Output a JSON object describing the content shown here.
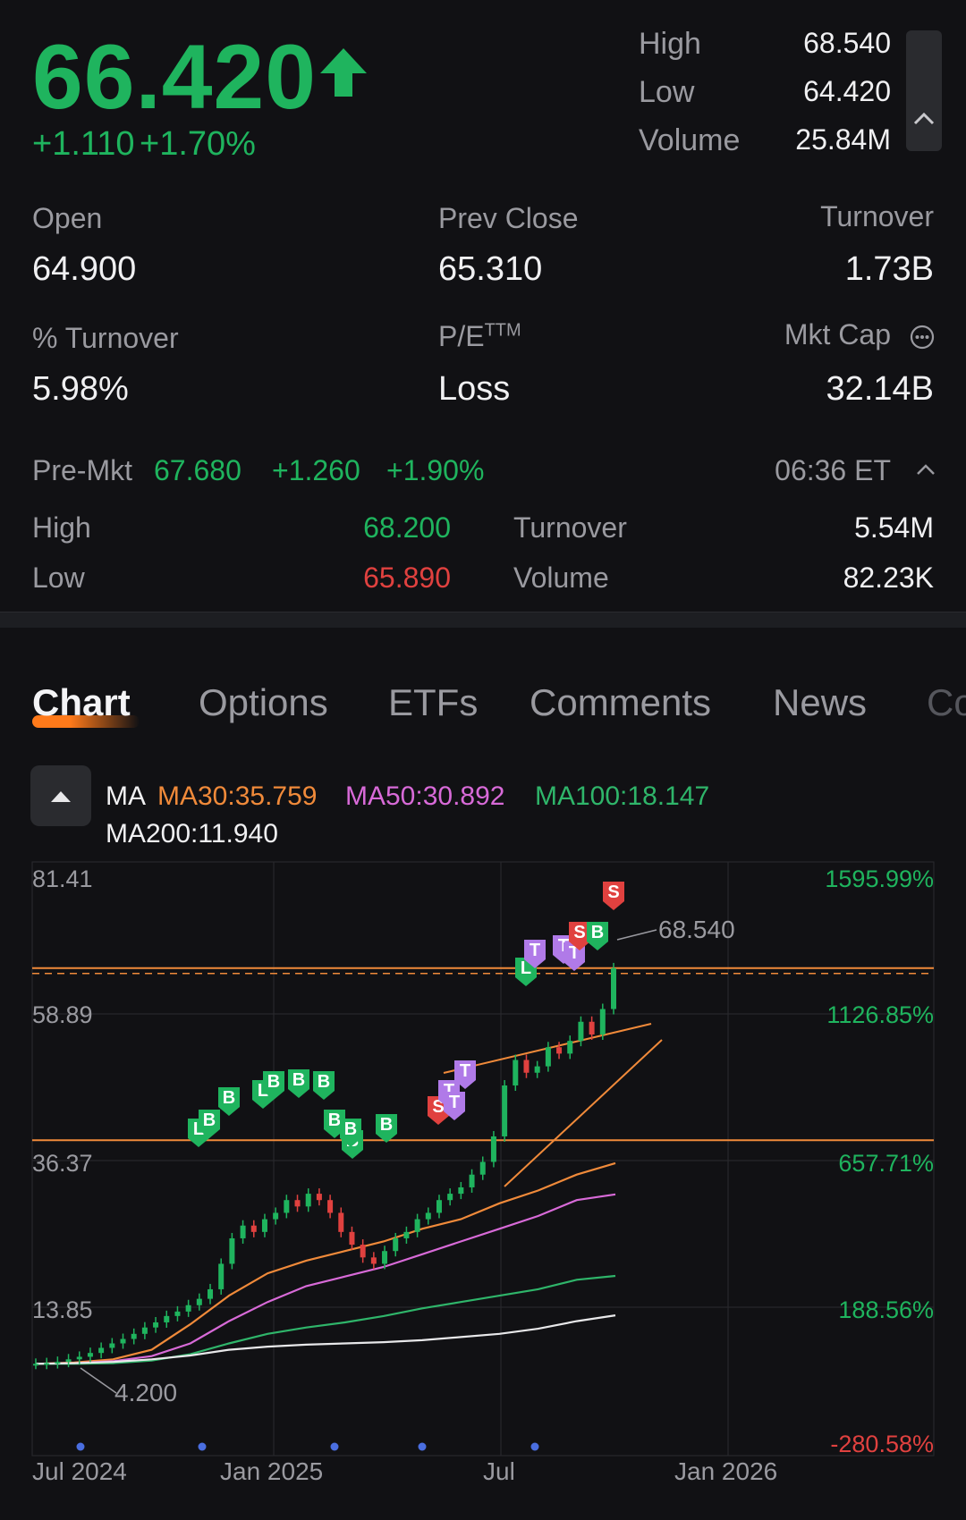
{
  "quote": {
    "price": "66.420",
    "change": "+1.110",
    "change_pct": "+1.70%",
    "high_label": "High",
    "high": "68.540",
    "low_label": "Low",
    "low": "64.420",
    "volume_label": "Volume",
    "volume": "25.84M"
  },
  "stats": {
    "open_label": "Open",
    "open": "64.900",
    "prev_close_label": "Prev Close",
    "prev_close": "65.310",
    "turnover_label": "Turnover",
    "turnover": "1.73B",
    "pct_turnover_label": "% Turnover",
    "pct_turnover": "5.98%",
    "pe_label": "P/E",
    "pe_sup": "TTM",
    "pe": "Loss",
    "mkt_cap_label": "Mkt Cap",
    "mkt_cap": "32.14B"
  },
  "premarket": {
    "label": "Pre-Mkt",
    "price": "67.680",
    "change": "+1.260",
    "change_pct": "+1.90%",
    "time": "06:36 ET",
    "high_label": "High",
    "high": "68.200",
    "low_label": "Low",
    "low": "65.890",
    "turnover_label": "Turnover",
    "turnover": "5.54M",
    "volume_label": "Volume",
    "volume": "82.23K"
  },
  "tabs": [
    "Chart",
    "Options",
    "ETFs",
    "Comments",
    "News",
    "Co"
  ],
  "ma": {
    "label": "MA",
    "ma30": "MA30:35.759",
    "ma50": "MA50:30.892",
    "ma100": "MA100:18.147",
    "ma200": "MA200:11.940"
  },
  "colors": {
    "up": "#1fb45e",
    "down": "#e0413f",
    "ma30": "#f08a3a",
    "ma50": "#d86ad8",
    "ma100": "#2fb56a",
    "ma200": "#e8e8ea",
    "bg": "#111114"
  },
  "chart_data": {
    "type": "line",
    "y_left_ticks": [
      "81.41",
      "58.89",
      "36.37",
      "13.85"
    ],
    "y_right_ticks": [
      "1595.99%",
      "1126.85%",
      "657.71%",
      "188.56%",
      "-280.58%"
    ],
    "x_ticks": [
      "Jul 2024",
      "Jan 2025",
      "Jul",
      "Jan 2026"
    ],
    "annotations": {
      "high_label": "68.540",
      "low_label": "4.200"
    },
    "ylim": [
      4.2,
      81.41
    ],
    "x": [
      "2024-07",
      "2024-08",
      "2024-09",
      "2024-10",
      "2024-11",
      "2024-12",
      "2025-01",
      "2025-02",
      "2025-03",
      "2025-04",
      "2025-05",
      "2025-06",
      "2025-07",
      "2025-08",
      "2025-09",
      "2025-10"
    ],
    "series": [
      {
        "name": "MA30",
        "values": [
          4.3,
          4.5,
          5.0,
          6.5,
          10.5,
          15.0,
          18.5,
          20.5,
          22.0,
          23.5,
          25.5,
          27.0,
          29.5,
          31.5,
          34.0,
          35.8
        ]
      },
      {
        "name": "MA50",
        "values": [
          4.3,
          4.4,
          4.7,
          5.5,
          7.5,
          11.0,
          14.0,
          16.5,
          18.0,
          19.5,
          21.5,
          23.5,
          25.5,
          27.5,
          30.0,
          30.9
        ]
      },
      {
        "name": "MA100",
        "values": [
          4.3,
          4.3,
          4.4,
          4.8,
          5.8,
          7.5,
          9.0,
          10.0,
          10.8,
          11.8,
          13.0,
          14.0,
          15.0,
          16.0,
          17.5,
          18.1
        ]
      },
      {
        "name": "MA200",
        "values": [
          4.3,
          4.4,
          4.6,
          5.0,
          5.6,
          6.5,
          7.0,
          7.3,
          7.5,
          7.7,
          8.0,
          8.5,
          9.0,
          9.8,
          11.0,
          11.9
        ]
      }
    ],
    "price_lines": [
      66.42,
      39.4
    ],
    "markers": [
      "L",
      "B",
      "B",
      "L",
      "B",
      "B",
      "B",
      "B",
      "B",
      "B",
      "B",
      "S",
      "T",
      "T",
      "T",
      "L",
      "T",
      "T",
      "T",
      "S",
      "B",
      "S"
    ]
  }
}
